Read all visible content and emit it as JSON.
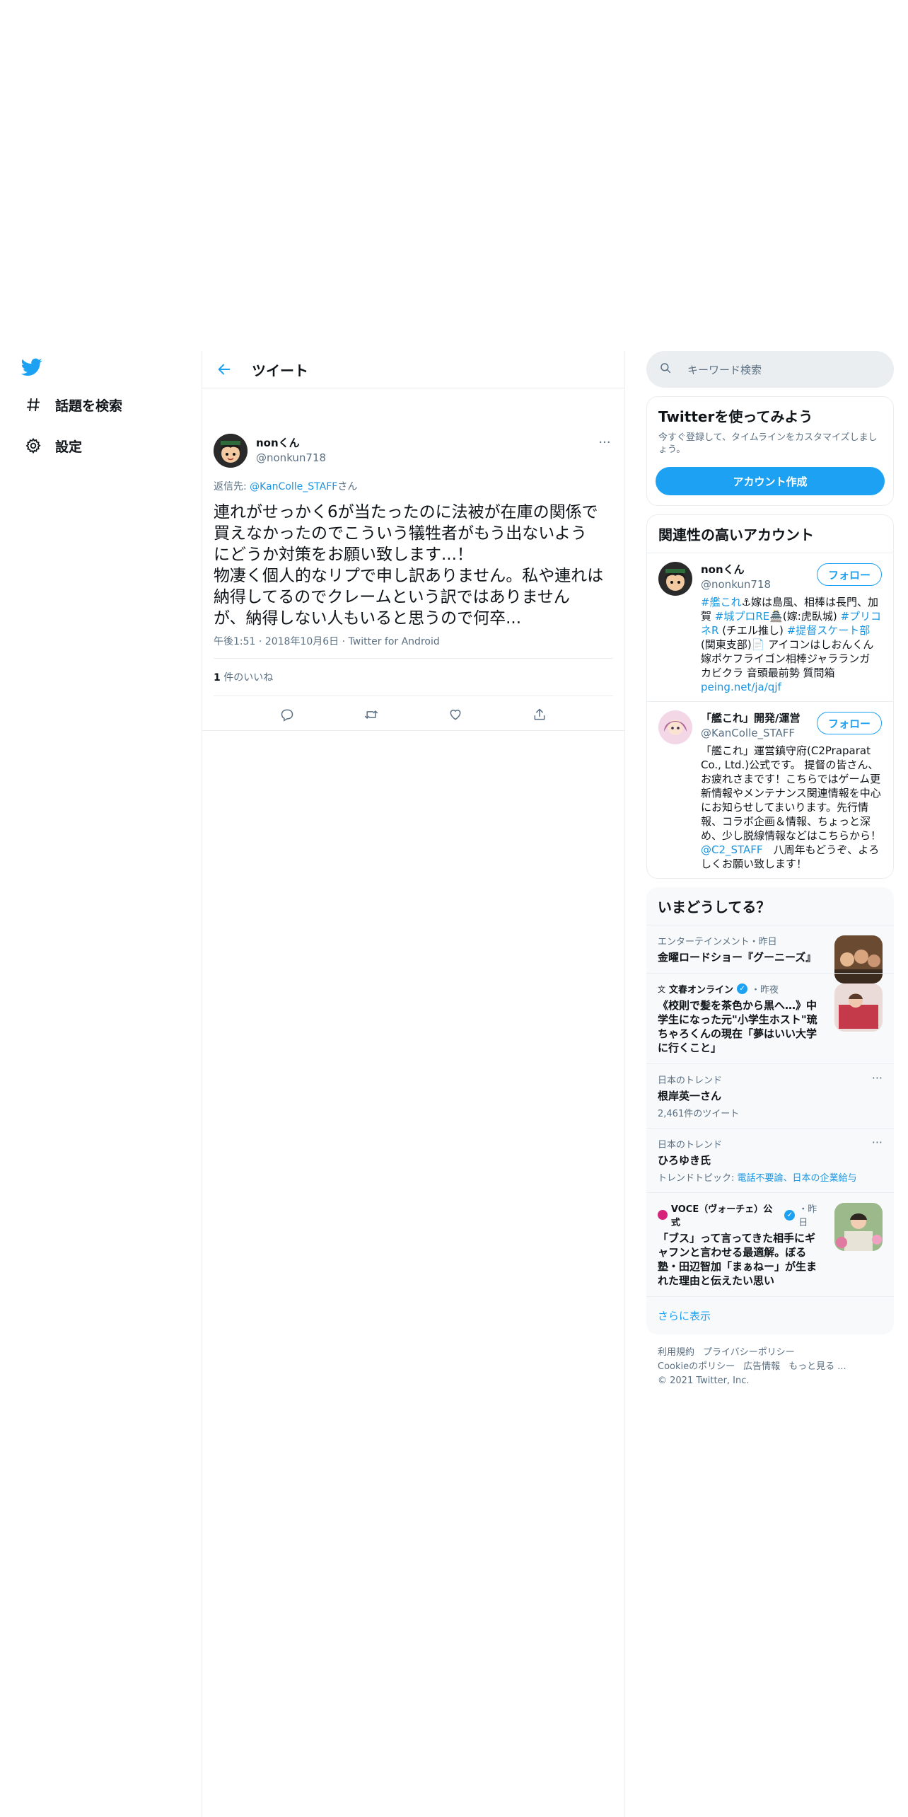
{
  "nav": {
    "logo": "twitter-bird-icon",
    "explore_label": "話題を検索",
    "settings_label": "設定"
  },
  "main": {
    "header_title": "ツイート",
    "tweet": {
      "name": "nonくん",
      "handle": "@nonkun718",
      "reply_prefix": "返信先: ",
      "reply_handle": "@KanColle_STAFF",
      "reply_suffix": "さん",
      "text": "連れがせっかく6が当たったのに法被が在庫の関係で\n買えなかったのでこういう犠牲者がもう出ないよう\nにどうか対策をお願い致します...！\n物凄く個人的なリプで申し訳ありません。私や連れは\n納得してるのでクレームという訳ではありません\nが、納得しない人もいると思うので何卒...",
      "time": "午後1:51",
      "date": "2018年10月6日",
      "client": "Twitter for Android",
      "likes_count": "1",
      "likes_label": " 件のいいね"
    }
  },
  "right": {
    "search_placeholder": "キーワード検索",
    "signup": {
      "title": "Twitterを使ってみよう",
      "subtitle": "今すぐ登録して、タイムラインをカスタマイズしましょう。",
      "button": "アカウント作成"
    },
    "relevant": {
      "title": "関連性の高いアカウント",
      "follow_label": "フォロー",
      "accounts": [
        {
          "name": "nonくん",
          "handle": "@nonkun718",
          "bio": [
            {
              "t": "#艦これ",
              "link": true
            },
            {
              "t": "⚓嫁は島風、相棒は長門、加賀 ",
              "link": false
            },
            {
              "t": "#城プロRE",
              "link": true
            },
            {
              "t": "🏯(嫁:虎臥城) ",
              "link": false
            },
            {
              "t": "#プリコネR",
              "link": true
            },
            {
              "t": " (チエル推し) ",
              "link": false
            },
            {
              "t": "#提督スケート部",
              "link": true
            },
            {
              "t": " (関東支部)📄 アイコンはしおんくん 嫁ポケフライゴン相棒ジャラランガ カビクラ 音頭最前勢 質問箱",
              "link": false
            },
            {
              "t": "peing.net/ja/qjf",
              "link": true
            }
          ]
        },
        {
          "name": "「艦これ」開発/運営",
          "handle": "@KanColle_STAFF",
          "bio": [
            {
              "t": "「艦これ」運営鎮守府(C2Praparat Co., Ltd.)公式です。 提督の皆さん、お疲れさまです！こちらではゲーム更新情報やメンテナンス関連情報を中心にお知らせしてまいります。先行情報、コラボ企画＆情報、ちょっと深め、少し脱線情報などはこちらから！ ",
              "link": false
            },
            {
              "t": "@C2_STAFF",
              "link": true
            },
            {
              "t": "　八周年もどうぞ、よろしくお願い致します！",
              "link": false
            }
          ]
        }
      ]
    },
    "trends": {
      "title": "いまどうしてる？",
      "items": [
        {
          "category": "エンターテインメント・昨日",
          "title": "金曜ロードショー『グーニーズ』"
        },
        {
          "source": "文春オンライン",
          "when": "・昨夜",
          "title": "《校則で髪を茶色から黒へ…》中学生になった元\"小学生ホスト\"琉ちゃろくんの現在「夢はいい大学に行くこと」"
        },
        {
          "category": "日本のトレンド",
          "title": "根岸英一さん",
          "count": "2,461件のツイート"
        },
        {
          "category": "日本のトレンド",
          "title": "ひろゆき氏",
          "topic_prefix": "トレンドトピック: ",
          "topic": "電話不要論、日本の企業給与"
        },
        {
          "source": "VOCE（ヴォーチェ）公式",
          "when": "・昨日",
          "title": "「ブス」って言ってきた相手にギャフンと言わせる最適解。ぼる塾・田辺智加「まぁねー」が生まれた理由と伝えたい思い"
        }
      ],
      "show_more": "さらに表示"
    },
    "footer": {
      "terms": "利用規約",
      "privacy": "プライバシーポリシー",
      "cookies": "Cookieのポリシー",
      "ads": "広告情報",
      "more": "もっと見る ...",
      "copyright": "© 2021 Twitter, Inc."
    }
  },
  "colors": {
    "accent": "#1da1f2",
    "text": "#0f1419",
    "muted": "#5b7083",
    "border": "#ebeef0"
  }
}
